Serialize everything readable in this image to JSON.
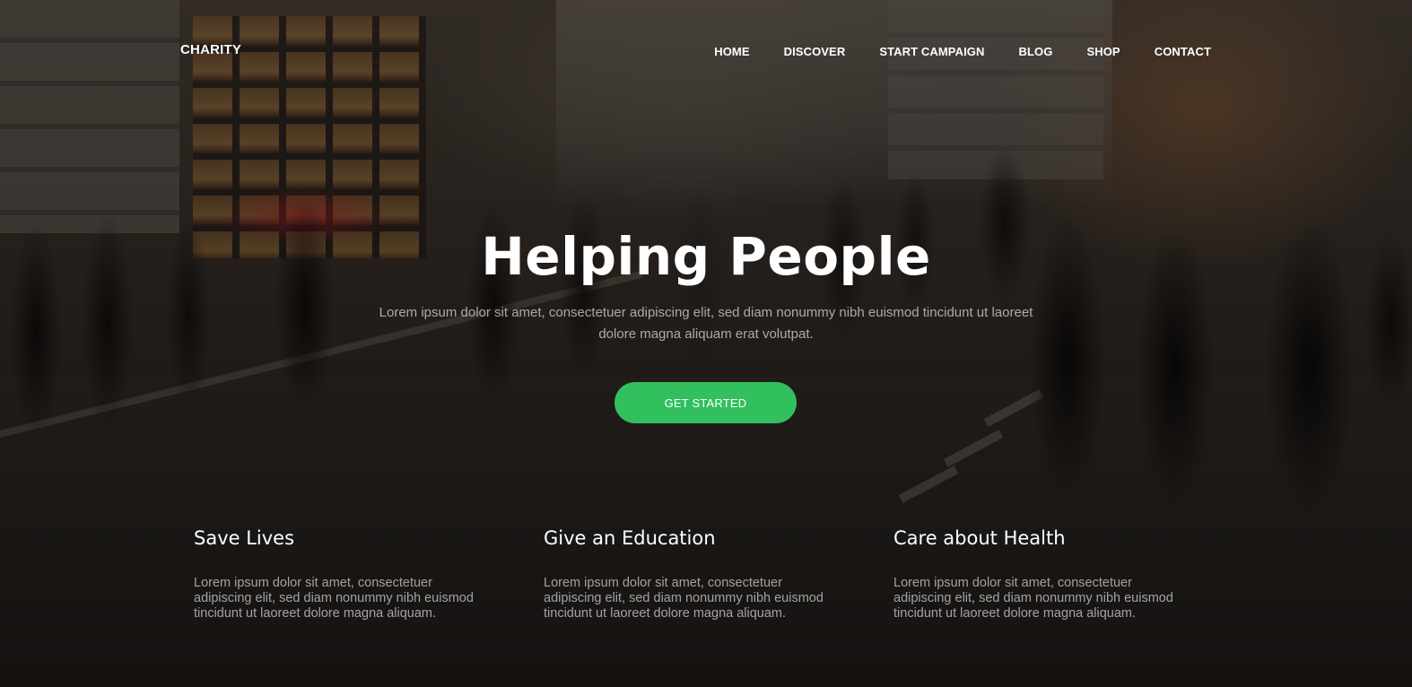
{
  "brand": {
    "name": "CHARITY"
  },
  "nav": {
    "items": [
      {
        "label": "HOME"
      },
      {
        "label": "DISCOVER"
      },
      {
        "label": "START CAMPAIGN"
      },
      {
        "label": "BLOG"
      },
      {
        "label": "SHOP"
      },
      {
        "label": "CONTACT"
      }
    ]
  },
  "hero": {
    "title": "Helping People",
    "subtitle": "Lorem ipsum dolor sit amet, consectetuer adipiscing elit, sed diam nonummy nibh euismod tincidunt ut laoreet dolore magna aliquam erat volutpat.",
    "cta_label": "GET STARTED",
    "cta_color": "#32c05f"
  },
  "features": [
    {
      "title": "Save Lives",
      "text": "Lorem ipsum dolor sit amet, consectetuer adipiscing elit, sed diam nonummy nibh euismod tincidunt ut laoreet dolore magna aliquam."
    },
    {
      "title": "Give an Education",
      "text": "Lorem ipsum dolor sit amet, consectetuer adipiscing elit, sed diam nonummy nibh euismod tincidunt ut laoreet dolore magna aliquam."
    },
    {
      "title": "Care about Health",
      "text": "Lorem ipsum dolor sit amet, consectetuer adipiscing elit, sed diam nonummy nibh euismod tincidunt ut laoreet dolore magna aliquam."
    }
  ]
}
